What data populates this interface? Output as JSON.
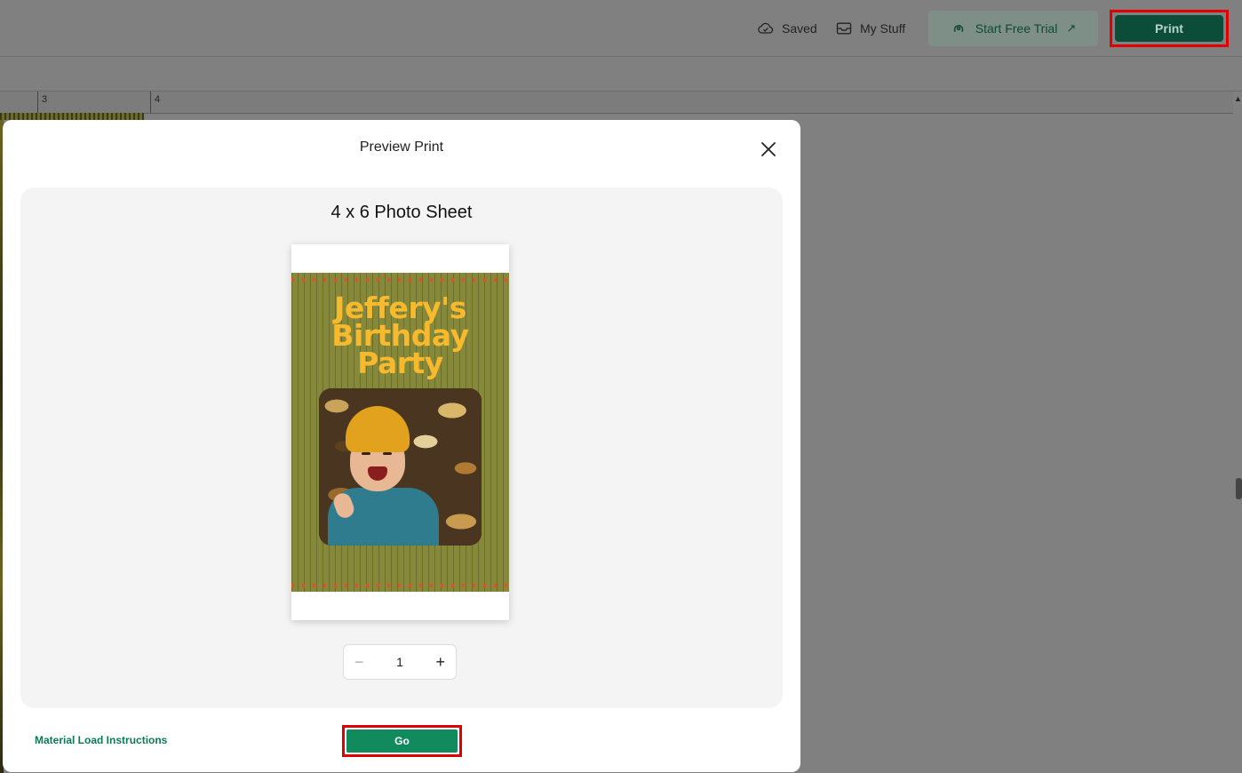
{
  "topbar": {
    "saved_label": "Saved",
    "mystuff_label": "My Stuff",
    "trial_label": "Start Free Trial",
    "print_label": "Print"
  },
  "ruler": {
    "marks": [
      "3",
      "4"
    ]
  },
  "modal": {
    "title": "Preview Print",
    "sheet_title": "4 x 6 Photo Sheet",
    "card_title_lines": [
      "Jeffery's",
      "Birthday",
      "Party"
    ],
    "quantity": "1",
    "material_link": "Material Load Instructions",
    "go_label": "Go"
  },
  "colors": {
    "accent_green": "#118a5d",
    "print_green": "#0b4d39",
    "highlight_red": "#e00000",
    "card_olive": "#86883a",
    "card_title_yellow": "#f7b92e"
  }
}
